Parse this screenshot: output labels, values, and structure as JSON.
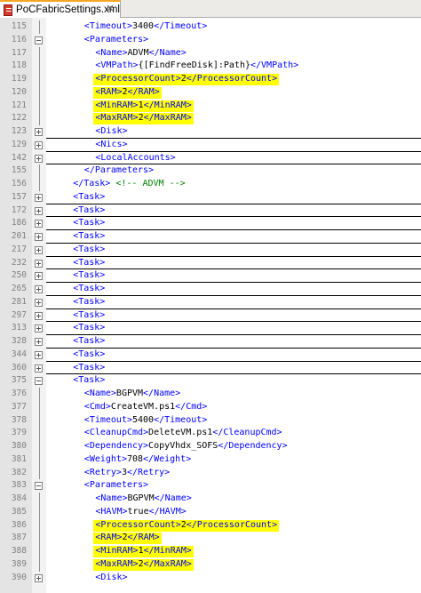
{
  "tab": {
    "title": "PoCFabricSettings.xml",
    "close": "✕"
  },
  "lines": [
    {
      "ln": "115",
      "fold": "",
      "indent": 3,
      "parts": [
        [
          "t",
          "<Timeout>"
        ],
        [
          "v",
          "3400"
        ],
        [
          "t",
          "</Timeout>"
        ]
      ]
    },
    {
      "ln": "116",
      "fold": "minus",
      "indent": 3,
      "parts": [
        [
          "t",
          "<Parameters>"
        ]
      ]
    },
    {
      "ln": "117",
      "fold": "",
      "indent": 4,
      "parts": [
        [
          "t",
          "<Name>"
        ],
        [
          "v",
          "ADVM"
        ],
        [
          "t",
          "</Name>"
        ]
      ]
    },
    {
      "ln": "118",
      "fold": "",
      "indent": 4,
      "parts": [
        [
          "t",
          "<VMPath>"
        ],
        [
          "v",
          "{[FindFreeDisk]:Path}"
        ],
        [
          "t",
          "</VMPath>"
        ]
      ]
    },
    {
      "ln": "119",
      "fold": "",
      "indent": 4,
      "hl": true,
      "parts": [
        [
          "t",
          "<ProcessorCount>"
        ],
        [
          "v",
          "2"
        ],
        [
          "t",
          "</ProcessorCount>"
        ]
      ]
    },
    {
      "ln": "120",
      "fold": "",
      "indent": 4,
      "hl": true,
      "parts": [
        [
          "t",
          "<RAM>"
        ],
        [
          "v",
          "2"
        ],
        [
          "t",
          "</RAM>"
        ]
      ]
    },
    {
      "ln": "121",
      "fold": "",
      "indent": 4,
      "hl": true,
      "parts": [
        [
          "t",
          "<MinRAM>"
        ],
        [
          "v",
          "1"
        ],
        [
          "t",
          "</MinRAM>"
        ]
      ]
    },
    {
      "ln": "122",
      "fold": "",
      "indent": 4,
      "hl": true,
      "parts": [
        [
          "t",
          "<MaxRAM>"
        ],
        [
          "v",
          "2"
        ],
        [
          "t",
          "</MaxRAM>"
        ]
      ]
    },
    {
      "ln": "123",
      "fold": "plus",
      "indent": 4,
      "ul": true,
      "parts": [
        [
          "t",
          "<Disk>"
        ]
      ]
    },
    {
      "ln": "129",
      "fold": "plus",
      "indent": 4,
      "ul": true,
      "parts": [
        [
          "t",
          "<Nics>"
        ]
      ]
    },
    {
      "ln": "142",
      "fold": "plus",
      "indent": 4,
      "ul": true,
      "parts": [
        [
          "t",
          "<LocalAccounts>"
        ]
      ]
    },
    {
      "ln": "155",
      "fold": "",
      "indent": 3,
      "parts": [
        [
          "t",
          "</Parameters>"
        ]
      ]
    },
    {
      "ln": "156",
      "fold": "",
      "indent": 2,
      "parts": [
        [
          "t",
          "</Task>"
        ],
        [
          "v",
          " "
        ],
        [
          "c",
          "<!-- ADVM -->"
        ]
      ]
    },
    {
      "ln": "157",
      "fold": "plus",
      "indent": 2,
      "ul": true,
      "parts": [
        [
          "t",
          "<Task>"
        ]
      ]
    },
    {
      "ln": "172",
      "fold": "plus",
      "indent": 2,
      "ul": true,
      "parts": [
        [
          "t",
          "<Task>"
        ]
      ]
    },
    {
      "ln": "186",
      "fold": "plus",
      "indent": 2,
      "ul": true,
      "parts": [
        [
          "t",
          "<Task>"
        ]
      ]
    },
    {
      "ln": "201",
      "fold": "plus",
      "indent": 2,
      "ul": true,
      "parts": [
        [
          "t",
          "<Task>"
        ]
      ]
    },
    {
      "ln": "217",
      "fold": "plus",
      "indent": 2,
      "ul": true,
      "parts": [
        [
          "t",
          "<Task>"
        ]
      ]
    },
    {
      "ln": "232",
      "fold": "plus",
      "indent": 2,
      "ul": true,
      "parts": [
        [
          "t",
          "<Task>"
        ]
      ]
    },
    {
      "ln": "250",
      "fold": "plus",
      "indent": 2,
      "ul": true,
      "parts": [
        [
          "t",
          "<Task>"
        ]
      ]
    },
    {
      "ln": "265",
      "fold": "plus",
      "indent": 2,
      "ul": true,
      "parts": [
        [
          "t",
          "<Task>"
        ]
      ]
    },
    {
      "ln": "281",
      "fold": "plus",
      "indent": 2,
      "ul": true,
      "parts": [
        [
          "t",
          "<Task>"
        ]
      ]
    },
    {
      "ln": "297",
      "fold": "plus",
      "indent": 2,
      "ul": true,
      "parts": [
        [
          "t",
          "<Task>"
        ]
      ]
    },
    {
      "ln": "313",
      "fold": "plus",
      "indent": 2,
      "ul": true,
      "parts": [
        [
          "t",
          "<Task>"
        ]
      ]
    },
    {
      "ln": "328",
      "fold": "plus",
      "indent": 2,
      "ul": true,
      "parts": [
        [
          "t",
          "<Task>"
        ]
      ]
    },
    {
      "ln": "344",
      "fold": "plus",
      "indent": 2,
      "ul": true,
      "parts": [
        [
          "t",
          "<Task>"
        ]
      ]
    },
    {
      "ln": "360",
      "fold": "plus",
      "indent": 2,
      "ul": true,
      "parts": [
        [
          "t",
          "<Task>"
        ]
      ]
    },
    {
      "ln": "375",
      "fold": "minus",
      "indent": 2,
      "parts": [
        [
          "t",
          "<Task>"
        ]
      ]
    },
    {
      "ln": "376",
      "fold": "",
      "indent": 3,
      "parts": [
        [
          "t",
          "<Name>"
        ],
        [
          "v",
          "BGPVM"
        ],
        [
          "t",
          "</Name>"
        ]
      ]
    },
    {
      "ln": "377",
      "fold": "",
      "indent": 3,
      "parts": [
        [
          "t",
          "<Cmd>"
        ],
        [
          "v",
          "CreateVM.ps1"
        ],
        [
          "t",
          "</Cmd>"
        ]
      ]
    },
    {
      "ln": "378",
      "fold": "",
      "indent": 3,
      "parts": [
        [
          "t",
          "<Timeout>"
        ],
        [
          "v",
          "5400"
        ],
        [
          "t",
          "</Timeout>"
        ]
      ]
    },
    {
      "ln": "379",
      "fold": "",
      "indent": 3,
      "parts": [
        [
          "t",
          "<CleanupCmd>"
        ],
        [
          "v",
          "DeleteVM.ps1"
        ],
        [
          "t",
          "</CleanupCmd>"
        ]
      ]
    },
    {
      "ln": "380",
      "fold": "",
      "indent": 3,
      "parts": [
        [
          "t",
          "<Dependency>"
        ],
        [
          "v",
          "CopyVhdx_SOFS"
        ],
        [
          "t",
          "</Dependency>"
        ]
      ]
    },
    {
      "ln": "381",
      "fold": "",
      "indent": 3,
      "parts": [
        [
          "t",
          "<Weight>"
        ],
        [
          "v",
          "708"
        ],
        [
          "t",
          "</Weight>"
        ]
      ]
    },
    {
      "ln": "382",
      "fold": "",
      "indent": 3,
      "parts": [
        [
          "t",
          "<Retry>"
        ],
        [
          "v",
          "3"
        ],
        [
          "t",
          "</Retry>"
        ]
      ]
    },
    {
      "ln": "383",
      "fold": "minus",
      "indent": 3,
      "parts": [
        [
          "t",
          "<Parameters>"
        ]
      ]
    },
    {
      "ln": "384",
      "fold": "",
      "indent": 4,
      "parts": [
        [
          "t",
          "<Name>"
        ],
        [
          "v",
          "BGPVM"
        ],
        [
          "t",
          "</Name>"
        ]
      ]
    },
    {
      "ln": "385",
      "fold": "",
      "indent": 4,
      "parts": [
        [
          "t",
          "<HAVM>"
        ],
        [
          "v",
          "true"
        ],
        [
          "t",
          "</HAVM>"
        ]
      ]
    },
    {
      "ln": "386",
      "fold": "",
      "indent": 4,
      "hl": true,
      "parts": [
        [
          "t",
          "<ProcessorCount>"
        ],
        [
          "v",
          "2"
        ],
        [
          "t",
          "</ProcessorCount>"
        ]
      ]
    },
    {
      "ln": "387",
      "fold": "",
      "indent": 4,
      "hl": true,
      "parts": [
        [
          "t",
          "<RAM>"
        ],
        [
          "v",
          "2"
        ],
        [
          "t",
          "</RAM>"
        ]
      ]
    },
    {
      "ln": "388",
      "fold": "",
      "indent": 4,
      "hl": true,
      "parts": [
        [
          "t",
          "<MinRAM>"
        ],
        [
          "v",
          "1"
        ],
        [
          "t",
          "</MinRAM>"
        ]
      ]
    },
    {
      "ln": "389",
      "fold": "",
      "indent": 4,
      "hl": true,
      "parts": [
        [
          "t",
          "<MaxRAM>"
        ],
        [
          "v",
          "2"
        ],
        [
          "t",
          "</MaxRAM>"
        ]
      ]
    },
    {
      "ln": "390",
      "fold": "plus",
      "indent": 4,
      "parts": [
        [
          "t",
          "<Disk>"
        ]
      ]
    }
  ],
  "colors": {
    "tag": "#0000ff",
    "value": "#000000",
    "comment": "#008000",
    "highlight": "#ffff00",
    "accent": "#f4a522"
  }
}
